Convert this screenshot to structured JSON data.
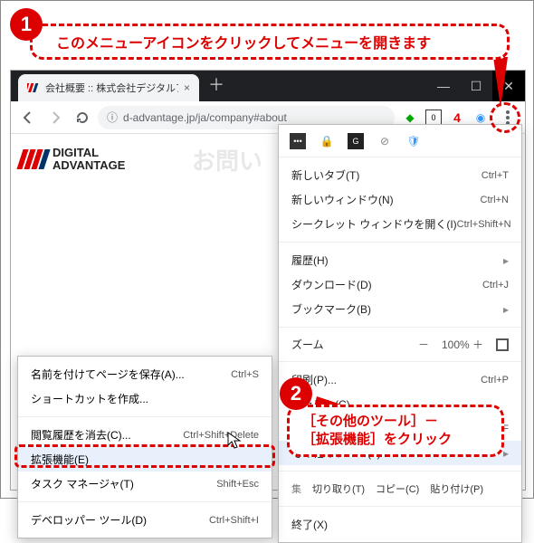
{
  "callout1": {
    "text": "このメニューアイコンをクリックしてメニューを開きます",
    "badge": "1"
  },
  "callout2": {
    "badge": "2",
    "line1": "［その他のツール］－",
    "line2": "［拡張機能］をクリック"
  },
  "tab": {
    "title": "会社概要 :: 株式会社デジタルアドバ"
  },
  "addr": {
    "url": "d-advantage.jp/ja/company#about"
  },
  "ext_badge": {
    "red_number": "4",
    "qr_count": "0"
  },
  "logo": {
    "line1": "DIGITAL",
    "line2": "ADVANTAGE"
  },
  "faded": "お問い",
  "menu": {
    "newtab": {
      "label": "新しいタブ(T)",
      "shortcut": "Ctrl+T"
    },
    "newwin": {
      "label": "新しいウィンドウ(N)",
      "shortcut": "Ctrl+N"
    },
    "incog": {
      "label": "シークレット ウィンドウを開く(I)",
      "shortcut": "Ctrl+Shift+N"
    },
    "history": {
      "label": "履歴(H)"
    },
    "download": {
      "label": "ダウンロード(D)",
      "shortcut": "Ctrl+J"
    },
    "bookmark": {
      "label": "ブックマーク(B)"
    },
    "zoom": {
      "label": "ズーム",
      "minus": "－",
      "value": "100%",
      "plus": "＋"
    },
    "print": {
      "label": "印刷(P)...",
      "shortcut": "Ctrl+P"
    },
    "cast": {
      "label": "キャスト(C)..."
    },
    "find": {
      "label": "検索(F)...",
      "shortcut": "Ctrl+F"
    },
    "more": {
      "label": "その他のツール(L)"
    },
    "edit": {
      "label": "集",
      "cut": "切り取り(T)",
      "copy": "コピー(C)",
      "paste": "貼り付け(P)"
    },
    "exit": {
      "label": "終了(X)"
    }
  },
  "submenu": {
    "save": {
      "label": "名前を付けてページを保存(A)...",
      "shortcut": "Ctrl+S"
    },
    "shortcut": {
      "label": "ショートカットを作成..."
    },
    "clear": {
      "label": "閲覧履歴を消去(C)...",
      "shortcut": "Ctrl+Shift+Delete"
    },
    "ext": {
      "label": "拡張機能(E)"
    },
    "task": {
      "label": "タスク マネージャ(T)",
      "shortcut": "Shift+Esc"
    },
    "dev": {
      "label": "デベロッパー ツール(D)",
      "shortcut": "Ctrl+Shift+I"
    }
  }
}
